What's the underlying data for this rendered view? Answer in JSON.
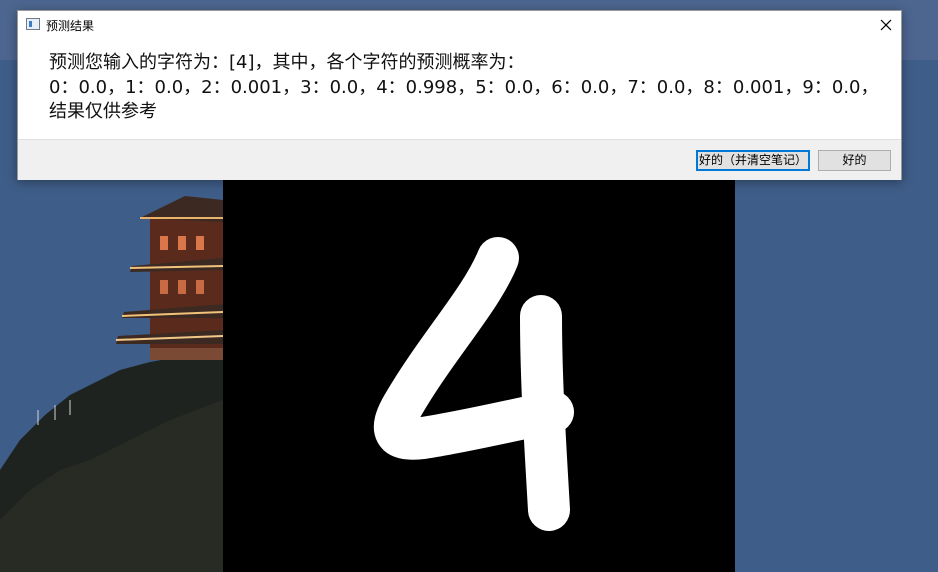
{
  "dialog": {
    "title": "预测结果",
    "message_lines": [
      "预测您输入的字符为：[4]，其中，各个字符的预测概率为：",
      "0：0.0，1：0.0，2：0.001，3：0.0，4：0.998，5：0.0，6：0.0，7：0.0，8：0.001，9：0.0，",
      "结果仅供参考"
    ],
    "buttons": {
      "ok_clear": "好的（并清空笔记）",
      "ok": "好的"
    }
  },
  "icons": {
    "title": "app-window-icon",
    "close": "close-icon"
  },
  "canvas": {
    "drawn_digit_color": "#ffffff",
    "background_color": "#000000"
  }
}
